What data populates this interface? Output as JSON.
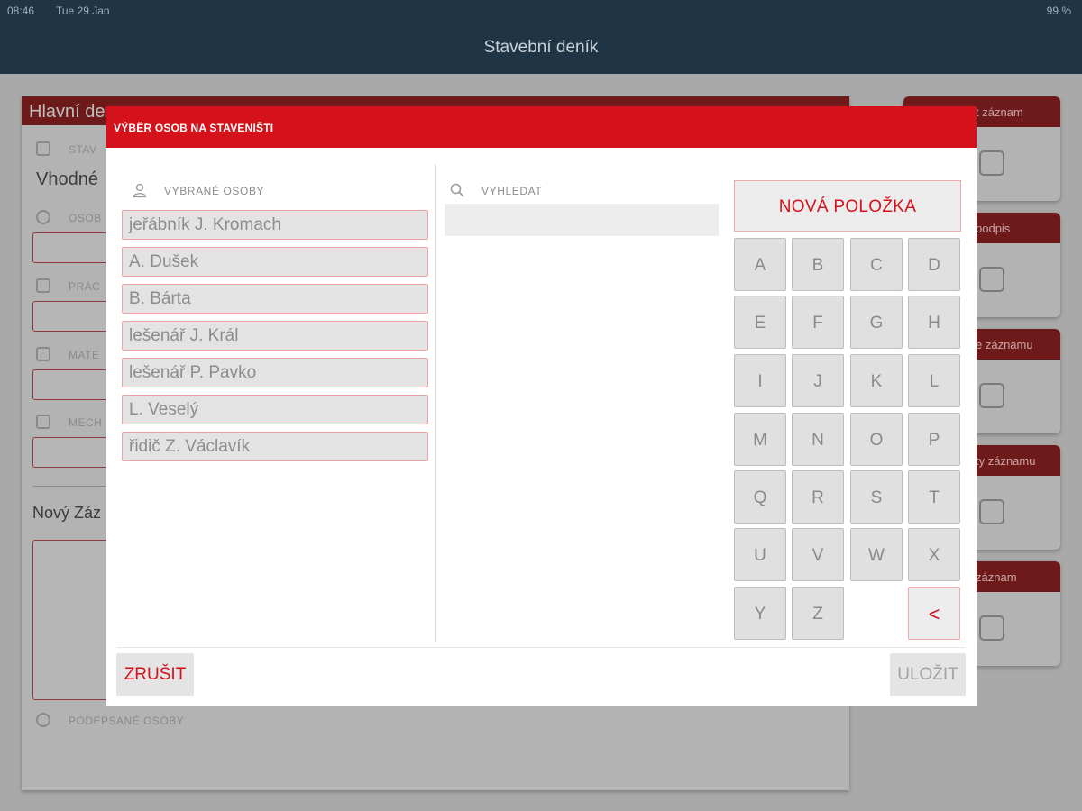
{
  "status_bar": {
    "time": "08:46",
    "date": "Tue 29 Jan",
    "battery": "99 %"
  },
  "nav": {
    "title": "Stavební deník"
  },
  "background_form": {
    "header": "Hlavní den",
    "field_label_1": "STAV",
    "field_value_1": "Vhodné",
    "field_label_2": "OSOB",
    "field_label_3": "PRÁC",
    "field_label_4": "MATE",
    "field_label_5": "MECH",
    "new_record_label": "Nový Záz",
    "signed_persons_label": "PODEPSANÉ OSOBY"
  },
  "side_cards": [
    {
      "label": "t záznam"
    },
    {
      "label": "podpis"
    },
    {
      "label": "e záznamu"
    },
    {
      "label": "ty záznamu"
    },
    {
      "label": "záznam"
    }
  ],
  "modal": {
    "title": "VÝBĚR OSOB NA STAVENIŠTI",
    "selected_label": "VYBRANÉ OSOBY",
    "search_label": "VYHLEDAT",
    "search_value": "",
    "new_item_label": "NOVÁ POLOŽKA",
    "persons": [
      "jeřábník J. Kromach",
      "A. Dušek",
      "B. Bárta",
      "lešenář J. Král",
      "lešenář P. Pavko",
      "L. Veselý",
      "řidič Z. Václavík"
    ],
    "keys": [
      "A",
      "B",
      "C",
      "D",
      "E",
      "F",
      "G",
      "H",
      "I",
      "J",
      "K",
      "L",
      "M",
      "N",
      "O",
      "P",
      "Q",
      "R",
      "S",
      "T",
      "U",
      "V",
      "W",
      "X",
      "Y",
      "Z"
    ],
    "backspace_label": "<",
    "cancel_label": "ZRUŠIT",
    "save_label": "ULOŽIT"
  }
}
